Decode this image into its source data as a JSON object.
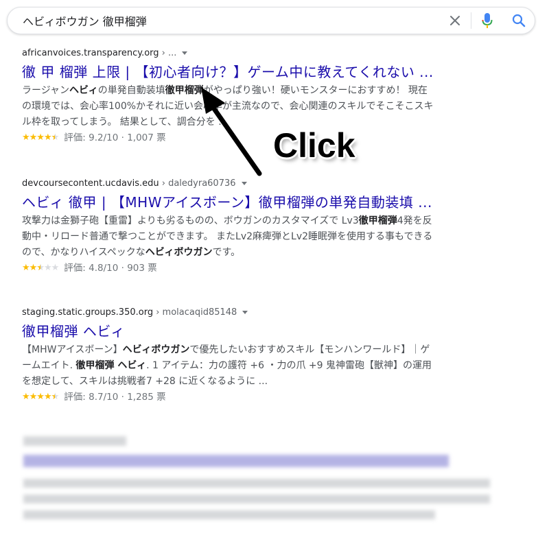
{
  "search": {
    "query": "ヘビィボウガン 徹甲榴弾"
  },
  "results": [
    {
      "domain": "africanvoices.transparency.org",
      "crumb": " › ...",
      "title": "徹 甲 榴弾 上限 | 【初心者向け？】ゲーム中に教えてくれない ...",
      "snippet": [
        "ラージャンヘビィの単発自動装填徹甲榴弾がやっぱり強い！硬いモンスターにおすすめ！ 現在",
        "の環境では、会心率100%かそれに近い会心率が主流なので、会心関連のスキルでそこそこスキ",
        "ル枠を取ってしまう。 結果として、調合分を ..."
      ],
      "rating_text": "評価: 9.2/10 · 1,007 票",
      "stars": 4.5
    },
    {
      "domain": "devcoursecontent.ucdavis.edu",
      "crumb": " › daledyra60736",
      "title": "ヘビィ 徹甲 | 【MHWアイスボーン】徹甲榴弾の単発自動装填 ...",
      "snippet": [
        "攻撃力は金獅子砲【重雷】よりも劣るものの、ボウガンのカスタマイズで Lv3徹甲榴弾4発を反",
        "動中・リロード普通で撃つことができます。 またLv2麻痺弾とLv2睡眠弾を使用する事もできる",
        "ので、かなりハイスペックなヘビィボウガンです。"
      ],
      "rating_text": "評価: 4.8/10 · 903 票",
      "stars": 2.5
    },
    {
      "domain": "staging.static.groups.350.org",
      "crumb": " › molacaqid85148",
      "title": "徹甲榴弾 ヘビィ",
      "snippet": [
        "【MHWアイスボーン】ヘビィボウガンで優先したいおすすめスキル【モンハンワールド】｜ゲ",
        "ームエイト. 徹甲榴弾 ヘビィ. 1 アイテム：力の護符 +6 ・力の爪 +9 鬼神雷砲【獣神】の運用",
        "を想定して、スキルは挑戦者7 +28 に近くなるように ..."
      ],
      "rating_text": "評価: 8.7/10 · 1,285 票",
      "stars": 4.5
    }
  ],
  "annotation": {
    "label": "Click"
  }
}
